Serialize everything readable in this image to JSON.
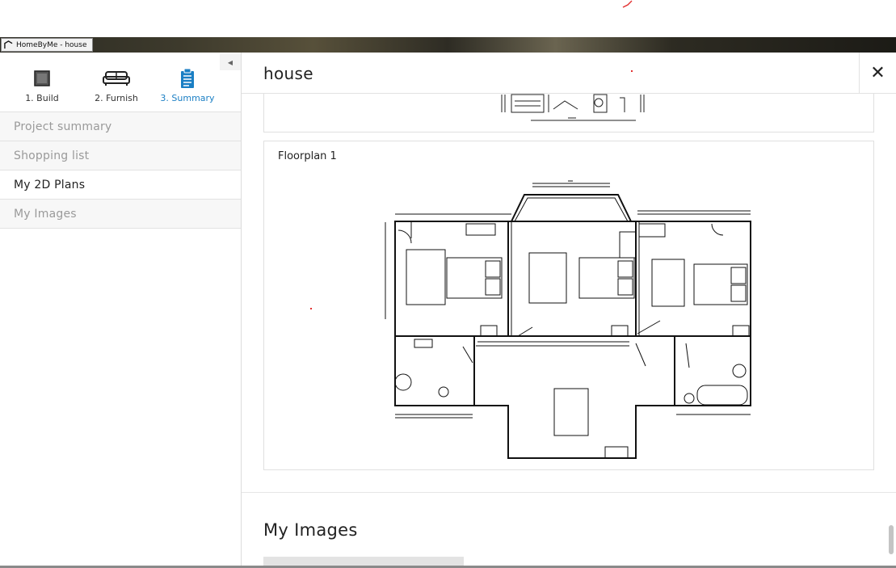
{
  "window": {
    "title": "HomeByMe - house"
  },
  "steps": [
    {
      "label": "1. Build",
      "icon": "square-icon",
      "active": false
    },
    {
      "label": "2. Furnish",
      "icon": "sofa-icon",
      "active": false
    },
    {
      "label": "3. Summary",
      "icon": "clipboard-icon",
      "active": true
    }
  ],
  "menu": [
    {
      "label": "Project summary",
      "selected": false
    },
    {
      "label": "Shopping list",
      "selected": false
    },
    {
      "label": "My 2D Plans",
      "selected": true
    },
    {
      "label": "My Images",
      "selected": false
    }
  ],
  "main": {
    "title": "house",
    "close_label": "✕",
    "floorplan_label": "Floorplan 1",
    "images_section_title": "My Images"
  },
  "colors": {
    "accent": "#1b7fc4",
    "muted_text": "#9a9a9a",
    "annotation_red": "#e23030"
  }
}
